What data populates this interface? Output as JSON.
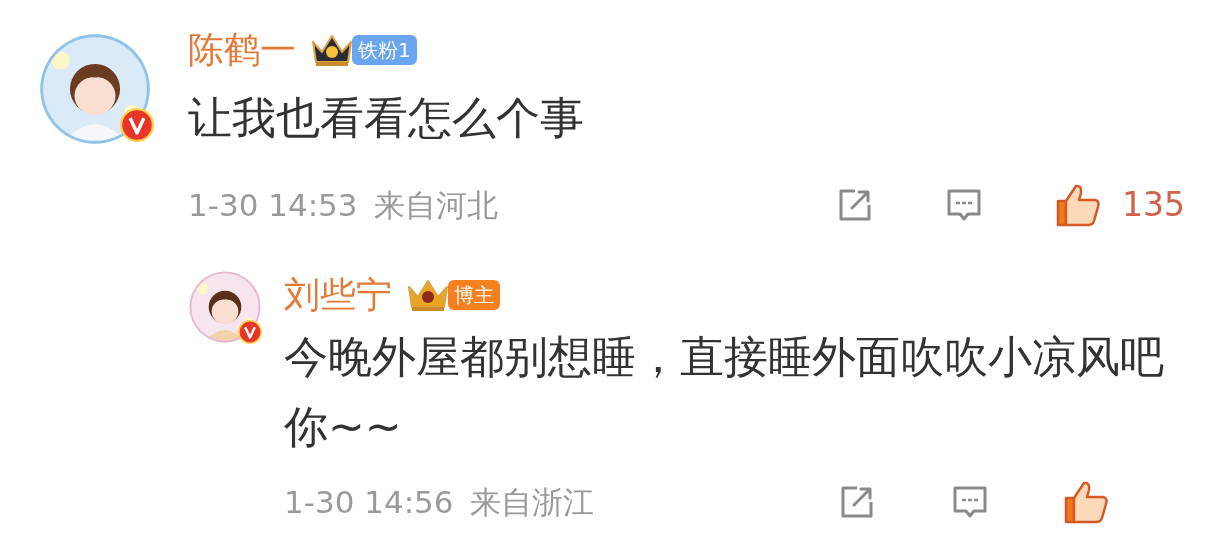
{
  "comments": [
    {
      "name": "陈鹤一",
      "verified": true,
      "badge": {
        "kind": "fan",
        "label": "铁粉1"
      },
      "text": "让我也看看怎么个事",
      "time": "1-30 14:53",
      "location": "来自河北",
      "liked": true,
      "likes": "135",
      "replies": [
        {
          "name": "刘些宁",
          "verified": true,
          "badge": {
            "kind": "author",
            "label": "博主"
          },
          "text": "今晚外屋都别想睡，直接睡外面吹吹小凉风吧你~~",
          "time": "1-30 14:56",
          "location": "来自浙江",
          "liked": true
        }
      ]
    }
  ]
}
